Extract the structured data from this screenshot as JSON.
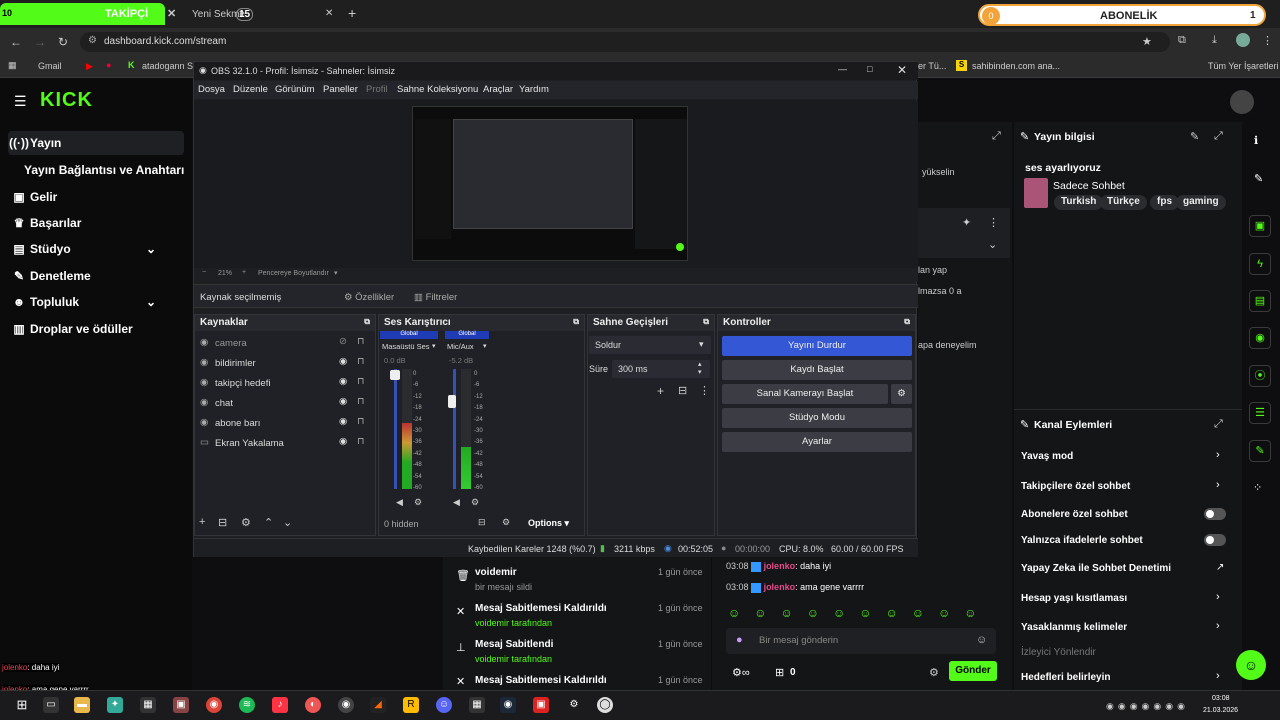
{
  "browser": {
    "tab1": {
      "badge": "10",
      "label": "TAKİPÇİ"
    },
    "tab2": {
      "label": "Yeni Sekme",
      "badge": "15"
    },
    "url": "dashboard.kick.com/stream",
    "bookmarks": [
      "Gmail",
      "atadogann Str",
      "er Tü...",
      "sahibinden.com ana...",
      "Tüm Yer İşaretleri"
    ],
    "sub_widget": {
      "count": "0",
      "label": "ABONELİK",
      "right": "1"
    }
  },
  "kick": {
    "logo": "KICK",
    "nav": [
      {
        "label": "Yayın",
        "icon": "broadcast-icon"
      },
      {
        "label": "Yayın Bağlantısı ve Anahtarı",
        "icon": ""
      },
      {
        "label": "Gelir",
        "icon": "wallet-icon"
      },
      {
        "label": "Başarılar",
        "icon": "trophy-icon"
      },
      {
        "label": "Stüdyo",
        "icon": "studio-icon"
      },
      {
        "label": "Denetleme",
        "icon": "wrench-icon"
      },
      {
        "label": "Topluluk",
        "icon": "people-icon"
      },
      {
        "label": "Droplar ve ödüller",
        "icon": "gift-icon"
      }
    ],
    "stream_info": {
      "header": "Yayın bilgisi",
      "title": "ses ayarlıyoruz",
      "category": "Sadece Sohbet",
      "tags": [
        "Turkish",
        "Türkçe",
        "fps",
        "gaming"
      ]
    },
    "behind_text": {
      "a": "yükselin",
      "b": "lan yap",
      "c": "lmazsa 0 a",
      "d": "apa deneyelim"
    },
    "actions": {
      "header": "Kanal Eylemleri",
      "items": [
        {
          "label": "Yavaş mod",
          "ctrl": "chevron"
        },
        {
          "label": "Takipçilere özel sohbet",
          "ctrl": "chevron"
        },
        {
          "label": "Abonelere özel sohbet",
          "ctrl": "toggle"
        },
        {
          "label": "Yalnızca ifadelerle sohbet",
          "ctrl": "toggle"
        },
        {
          "label": "Yapay Zeka ile Sohbet Denetimi",
          "ctrl": "external"
        },
        {
          "label": "Hesap yaşı kısıtlaması",
          "ctrl": "chevron"
        },
        {
          "label": "Yasaklanmış kelimeler",
          "ctrl": "chevron"
        },
        {
          "label": "İzleyici Yönlendir",
          "ctrl": "none"
        },
        {
          "label": "Hedefleri belirleyin",
          "ctrl": "chevron"
        }
      ]
    },
    "log": [
      {
        "title": "voidemir",
        "sub": "bir mesajı sildi",
        "time": "1 gün önce",
        "icon": "trash-icon"
      },
      {
        "title": "Mesaj Sabitlemesi Kaldırıldı",
        "sub": "voidemir tarafından",
        "time": "1 gün önce",
        "icon": "unpin-icon"
      },
      {
        "title": "Mesaj Sabitlendi",
        "sub": "voidemir tarafından",
        "time": "1 gün önce",
        "icon": "pin-icon"
      },
      {
        "title": "Mesaj Sabitlemesi Kaldırıldı",
        "sub": "",
        "time": "1 gün önce",
        "icon": "unpin-icon"
      }
    ],
    "chat": {
      "messages": [
        {
          "time": "03:08",
          "user": "jolenko",
          "text": ": daha iyi"
        },
        {
          "time": "03:08",
          "user": "jolenko",
          "text": ": ama gene varrrr"
        }
      ],
      "placeholder": "Bir mesaj gönderin",
      "send": "Gönder",
      "viewers": "0"
    },
    "overlay_chat": [
      {
        "user": "jolenko",
        "text": ": daha iyi"
      },
      {
        "user": "jolenko",
        "text": ": ama gene varrrr"
      }
    ]
  },
  "obs": {
    "title": "OBS 32.1.0 - Profil: İsimsiz - Sahneler: İsimsiz",
    "menu": [
      "Dosya",
      "Düzenle",
      "Görünüm",
      "Paneller",
      "Profil",
      "Sahne Koleksiyonu",
      "Araçlar",
      "Yardım"
    ],
    "zoom": "21%",
    "fit": "Pencereye Boyutlandır",
    "no_source": "Kaynak seçilmemiş",
    "props": "Özellikler",
    "filters": "Filtreler",
    "sources_header": "Kaynaklar",
    "sources": [
      {
        "name": "camera",
        "icon": "camera-icon",
        "visible": false
      },
      {
        "name": "bildirimler",
        "icon": "browser-icon",
        "visible": true
      },
      {
        "name": "takipçi hedefi",
        "icon": "browser-icon",
        "visible": true
      },
      {
        "name": "chat",
        "icon": "browser-icon",
        "visible": true
      },
      {
        "name": "abone barı",
        "icon": "browser-icon",
        "visible": true
      },
      {
        "name": "Ekran Yakalama",
        "icon": "monitor-icon",
        "visible": true
      }
    ],
    "mixer": {
      "header": "Ses Karıştırıcı",
      "channels": [
        {
          "tag": "Global",
          "name": "Masaüstü Ses",
          "db": "0.0 dB",
          "level": 0.55
        },
        {
          "tag": "Global",
          "name": "Mic/Aux",
          "db": "-5.2 dB",
          "level": 0.35
        }
      ],
      "scale": [
        "0",
        "-6",
        "-12",
        "-18",
        "-24",
        "-30",
        "-36",
        "-42",
        "-48",
        "-54",
        "-60"
      ],
      "hidden": "0 hidden",
      "options": "Options"
    },
    "transitions": {
      "header": "Sahne Geçişleri",
      "type": "Soldur",
      "duration_label": "Süre",
      "duration": "300 ms"
    },
    "controls": {
      "header": "Kontroller",
      "buttons": [
        "Yayını Durdur",
        "Kaydı Başlat",
        "Sanal Kamerayı Başlat",
        "Stüdyo Modu",
        "Ayarlar"
      ]
    },
    "status": {
      "dropped": "Kaybedilen Kareler 1248 (%0.7)",
      "kbps": "3211 kbps",
      "stream_time": "00:52:05",
      "rec_time": "00:00:00",
      "cpu": "CPU: 8.0%",
      "fps": "60.00 / 60.00 FPS"
    }
  },
  "taskbar": {
    "time": "03:08",
    "date": "21.03.2026"
  },
  "colors": {
    "kick_green": "#53fc18",
    "obs_blue": "#3457d5"
  }
}
